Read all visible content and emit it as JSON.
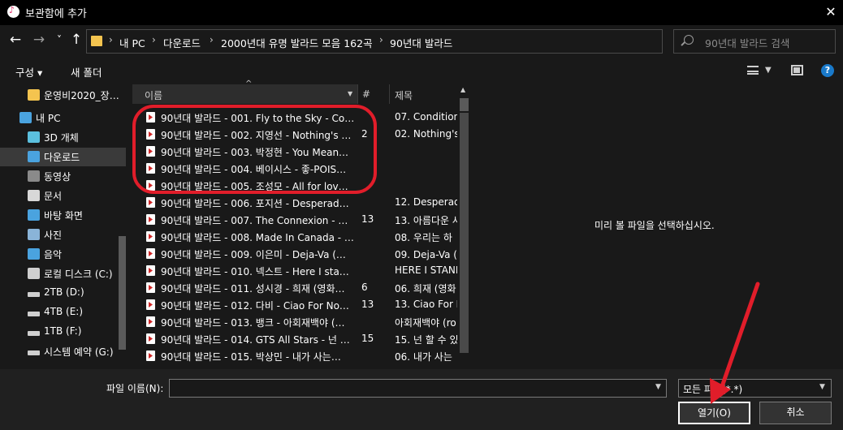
{
  "window": {
    "title": "보관함에 추가",
    "close_label": "✕"
  },
  "nav": {
    "back": "←",
    "forward": "→",
    "recent": "˅",
    "up": "↑",
    "breadcrumbs": [
      "내 PC",
      "다운로드",
      "2000년대 유명 발라드 모음 162곡",
      "90년대 발라드"
    ],
    "separator": "›",
    "refresh": "↻",
    "search_placeholder": "90년대 발라드 검색"
  },
  "toolbar": {
    "organize": "구성 ▾",
    "new_folder": "새 폴더",
    "help": "?"
  },
  "sidebar": {
    "items": [
      {
        "label": "운영비2020_장…",
        "icon": "folder-icon",
        "color": "#f4c44f"
      },
      {
        "label": "내 PC",
        "icon": "pc-icon",
        "color": "#4aa3df"
      },
      {
        "label": "3D 개체",
        "icon": "cube-icon",
        "color": "#5bc0de"
      },
      {
        "label": "다운로드",
        "icon": "download-icon",
        "color": "#4aa3df"
      },
      {
        "label": "동영상",
        "icon": "video-icon",
        "color": "#8a8a8a"
      },
      {
        "label": "문서",
        "icon": "document-icon",
        "color": "#d8d8d8"
      },
      {
        "label": "바탕 화면",
        "icon": "desktop-icon",
        "color": "#4aa3df"
      },
      {
        "label": "사진",
        "icon": "pictures-icon",
        "color": "#8ab4d8"
      },
      {
        "label": "음악",
        "icon": "music-icon",
        "color": "#4aa3df"
      },
      {
        "label": "로컬 디스크 (C:)",
        "icon": "disk-icon",
        "color": "#cfcfcf"
      },
      {
        "label": "2TB (D:)",
        "icon": "drive-icon",
        "color": "#cfcfcf"
      },
      {
        "label": "4TB (E:)",
        "icon": "drive-icon",
        "color": "#cfcfcf"
      },
      {
        "label": "1TB (F:)",
        "icon": "drive-icon",
        "color": "#cfcfcf"
      },
      {
        "label": "시스템 예약 (G:)",
        "icon": "drive-icon",
        "color": "#cfcfcf"
      }
    ],
    "selected_index": 3
  },
  "columns": {
    "name": "이름",
    "number": "#",
    "title": "제목",
    "sort_indicator": "^"
  },
  "files": [
    {
      "name": "90년대 발라드 - 001. Fly to the Sky - Co…",
      "num": "",
      "title": "07. Condition"
    },
    {
      "name": "90년대 발라드 - 002. 지영선 - Nothing's …",
      "num": "2",
      "title": "02. Nothing's"
    },
    {
      "name": "90년대 발라드 - 003. 박정현 - You Mean…",
      "num": "",
      "title": ""
    },
    {
      "name": "90년대 발라드 - 004. 베이시스 - 좋-POIS…",
      "num": "",
      "title": ""
    },
    {
      "name": "90년대 발라드 - 005. 조성모 - All for lov…",
      "num": "",
      "title": ""
    },
    {
      "name": "90년대 발라드 - 006. 포지션 - Desperad…",
      "num": "",
      "title": "12. Desperado"
    },
    {
      "name": "90년대 발라드 - 007. The Connexion - …",
      "num": "13",
      "title": "13. 아름다운 사"
    },
    {
      "name": "90년대 발라드 - 008. Made In Canada - …",
      "num": "",
      "title": "08. 우리는 하"
    },
    {
      "name": "90년대 발라드 - 009. 이은미 - Deja-Va (…",
      "num": "",
      "title": "09. Deja-Va (인"
    },
    {
      "name": "90년대 발라드 - 010. 넥스트 - Here I sta…",
      "num": "",
      "title": "HERE I STAND"
    },
    {
      "name": "90년대 발라드 - 011. 성시경 - 희재 (영화…",
      "num": "6",
      "title": "06. 희재 (영화"
    },
    {
      "name": "90년대 발라드 - 012. 다비 - Ciao For No…",
      "num": "13",
      "title": "13. Ciao For N"
    },
    {
      "name": "90년대 발라드 - 013. 뱅크 - 아회재백야 (…",
      "num": "",
      "title": "아회재백야 (ro"
    },
    {
      "name": "90년대 발라드 - 014. GTS All Stars - 넌 …",
      "num": "15",
      "title": "15. 넌 할 수 있"
    },
    {
      "name": "90년대 발라드 - 015. 박상민 - 내가 사는…",
      "num": "",
      "title": "06. 내가 사는"
    }
  ],
  "preview": {
    "message": "미리 볼 파일을 선택하십시오."
  },
  "footer": {
    "filename_label": "파일 이름(N):",
    "filename_value": "",
    "filetype_label": "모든 파일(*.*)",
    "open_label": "열기(O)",
    "cancel_label": "취소"
  },
  "annotation_color": "#e11d2a"
}
